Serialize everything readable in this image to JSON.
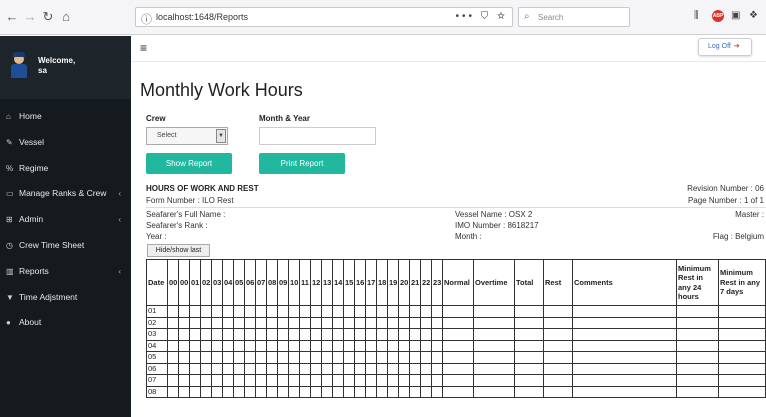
{
  "browser": {
    "url": "localhost:1648/Reports",
    "url_actions": "••• ⛉ ☆",
    "search_placeholder": "Search"
  },
  "sidebar": {
    "welcome_line1": "Welcome,",
    "welcome_line2": "sa",
    "items": [
      {
        "label": "Home",
        "icon": "⌂",
        "has_submenu": false
      },
      {
        "label": "Vessel",
        "icon": "✎",
        "has_submenu": false
      },
      {
        "label": "Regime",
        "icon": "%",
        "has_submenu": false
      },
      {
        "label": "Manage Ranks & Crew",
        "icon": "▭",
        "has_submenu": true
      },
      {
        "label": "Admin",
        "icon": "⊞",
        "has_submenu": true
      },
      {
        "label": "Crew Time Sheet",
        "icon": "◷",
        "has_submenu": false
      },
      {
        "label": "Reports",
        "icon": "▥",
        "has_submenu": true
      },
      {
        "label": "Time Adjstment",
        "icon": "▼",
        "has_submenu": false
      },
      {
        "label": "About",
        "icon": "●",
        "has_submenu": false
      }
    ],
    "chevron": "‹"
  },
  "header": {
    "logoff_label": "Log Off"
  },
  "page": {
    "title": "Monthly Work Hours",
    "crew_label": "Crew",
    "crew_selected": "Select",
    "month_year_label": "Month & Year",
    "month_year_value": "",
    "show_report_label": "Show Report",
    "print_report_label": "Print Report"
  },
  "report": {
    "heading": "HOURS OF WORK AND REST",
    "form_number": "Form Number : ILO Rest",
    "revision_number": "Revision Number : 06",
    "page_number": "Page Number : 1 of 1",
    "full_name": "Seafarer's Full Name :",
    "rank": "Seafarer's Rank :",
    "year": "Year :",
    "vessel_name": "Vessel Name : OSX 2",
    "imo_number": "IMO Number : 8618217",
    "month": "Month :",
    "master": "Master :",
    "flag": "Flag : Belgium",
    "hide_show_label": "Hide/show last"
  },
  "table": {
    "headers": [
      "Date",
      "00",
      "00",
      "01",
      "02",
      "03",
      "04",
      "05",
      "06",
      "07",
      "08",
      "09",
      "10",
      "11",
      "12",
      "13",
      "14",
      "15",
      "16",
      "17",
      "18",
      "19",
      "20",
      "21",
      "22",
      "23",
      "Normal",
      "Overtime",
      "Total",
      "Rest",
      "Comments",
      "Minimum Rest in any 24 hours",
      "Minimum Rest in any 7 days"
    ],
    "rows": [
      "01",
      "02",
      "03",
      "04",
      "05",
      "06",
      "07",
      "08"
    ]
  }
}
